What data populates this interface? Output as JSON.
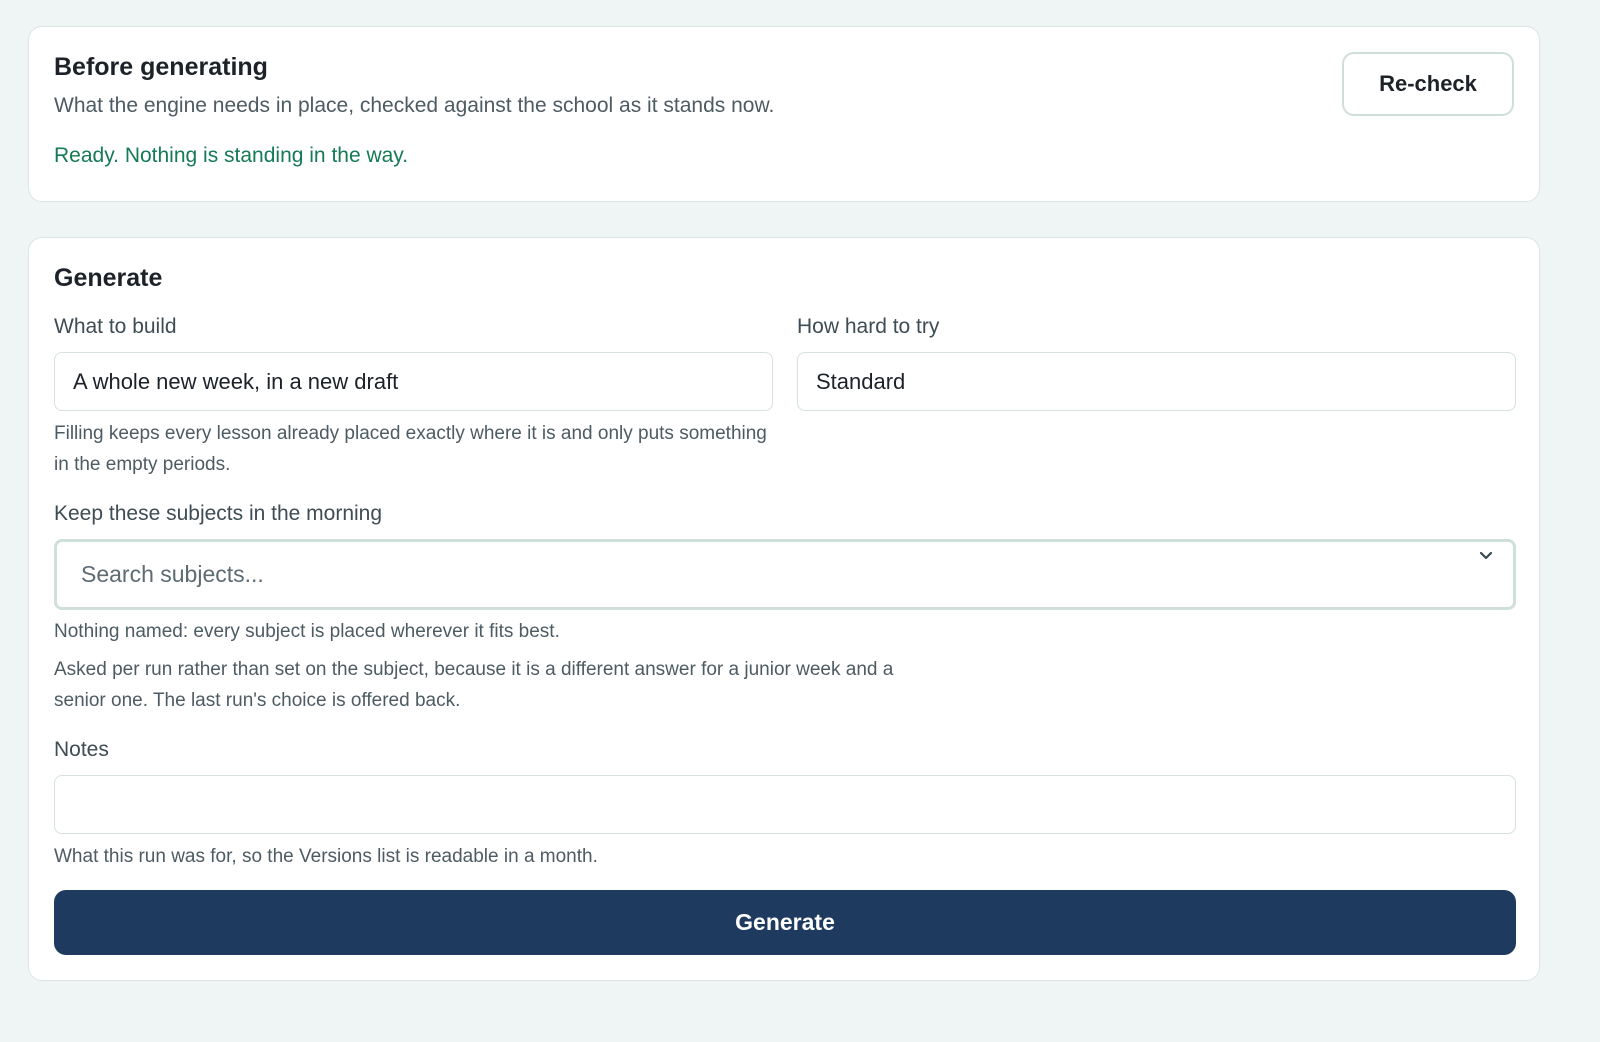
{
  "before": {
    "title": "Before generating",
    "subtitle": "What the engine needs in place, checked against the school as it stands now.",
    "status": "Ready. Nothing is standing in the way.",
    "recheck_label": "Re-check"
  },
  "generate": {
    "title": "Generate",
    "what_to_build": {
      "label": "What to build",
      "value": "A whole new week, in a new draft",
      "help": "Filling keeps every lesson already placed exactly where it is and only puts something in the empty periods."
    },
    "how_hard": {
      "label": "How hard to try",
      "value": "Standard"
    },
    "morning_subjects": {
      "label": "Keep these subjects in the morning",
      "placeholder": "Search subjects...",
      "help_1": "Nothing named: every subject is placed wherever it fits best.",
      "help_2": "Asked per run rather than set on the subject, because it is a different answer for a junior week and a senior one. The last run's choice is offered back."
    },
    "notes": {
      "label": "Notes",
      "value": "",
      "help": "What this run was for, so the Versions list is readable in a month."
    },
    "generate_label": "Generate"
  },
  "colors": {
    "background": "#eff5f4",
    "status_ok": "#157a55",
    "primary_button": "#1f3a5f"
  },
  "icons": {
    "dropdown": "chevron-down-icon"
  }
}
